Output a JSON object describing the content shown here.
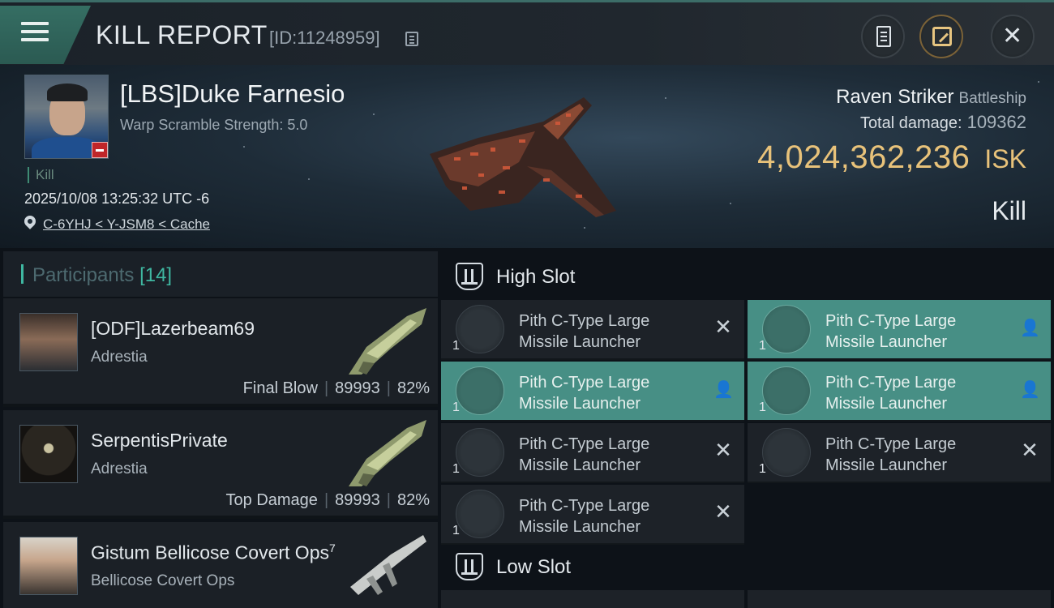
{
  "header": {
    "title": "KILL REPORT",
    "report_id": "[ID:11248959]",
    "menu_icon": "hamburger-menu-icon",
    "clipboard_icon": "clipboard-icon",
    "share_icon": "share-icon",
    "close_icon": "close-icon",
    "close_glyph": "✕"
  },
  "victim": {
    "name": "[LBS]Duke Farnesio",
    "warp_scramble": "Warp Scramble Strength: 5.0",
    "tag": "Kill",
    "datetime": "2025/10/08 13:25:32 UTC -6",
    "location": "C-6YHJ < Y-JSM8 < Cache",
    "ship_name": "Raven Striker",
    "ship_class": "Battleship",
    "total_damage_label": "Total damage:",
    "total_damage": "109362",
    "isk_value": "4,024,362,236",
    "isk_unit": "ISK",
    "result": "Kill"
  },
  "participants": {
    "label": "Participants",
    "count": "[14]",
    "rows": [
      {
        "name": "[ODF]Lazerbeam69",
        "corp": "Adrestia",
        "role": "Final Blow",
        "damage": "89993",
        "percent": "82%"
      },
      {
        "name": "SerpentisPrivate",
        "corp": "Adrestia",
        "role": "Top Damage",
        "damage": "89993",
        "percent": "82%"
      },
      {
        "name": "Gistum Bellicose Covert Ops",
        "sup": "7",
        "corp": "Bellicose Covert Ops"
      }
    ]
  },
  "slots": {
    "high": {
      "title": "High Slot",
      "modules": [
        {
          "name1": "Pith C-Type Large",
          "name2": "Missile Launcher",
          "qty": "1",
          "status": "✕"
        },
        {
          "name1": "Pith C-Type Large",
          "name2": "Missile Launcher",
          "qty": "1",
          "status": "👤"
        },
        {
          "name1": "Pith C-Type Large",
          "name2": "Missile Launcher",
          "qty": "1",
          "status": "👤"
        },
        {
          "name1": "Pith C-Type Large",
          "name2": "Missile Launcher",
          "qty": "1",
          "status": "👤"
        },
        {
          "name1": "Pith C-Type Large",
          "name2": "Missile Launcher",
          "qty": "1",
          "status": "✕"
        },
        {
          "name1": "Pith C-Type Large",
          "name2": "Missile Launcher",
          "qty": "1",
          "status": "✕"
        },
        {
          "name1": "Pith C-Type Large",
          "name2": "Missile Launcher",
          "qty": "1",
          "status": "✕"
        }
      ]
    },
    "low": {
      "title": "Low Slot"
    }
  },
  "colors": {
    "accent": "#3fb7a1",
    "isk_gold": "#e8c27a",
    "module_active": "#478f85",
    "danger": "#c0262a"
  }
}
